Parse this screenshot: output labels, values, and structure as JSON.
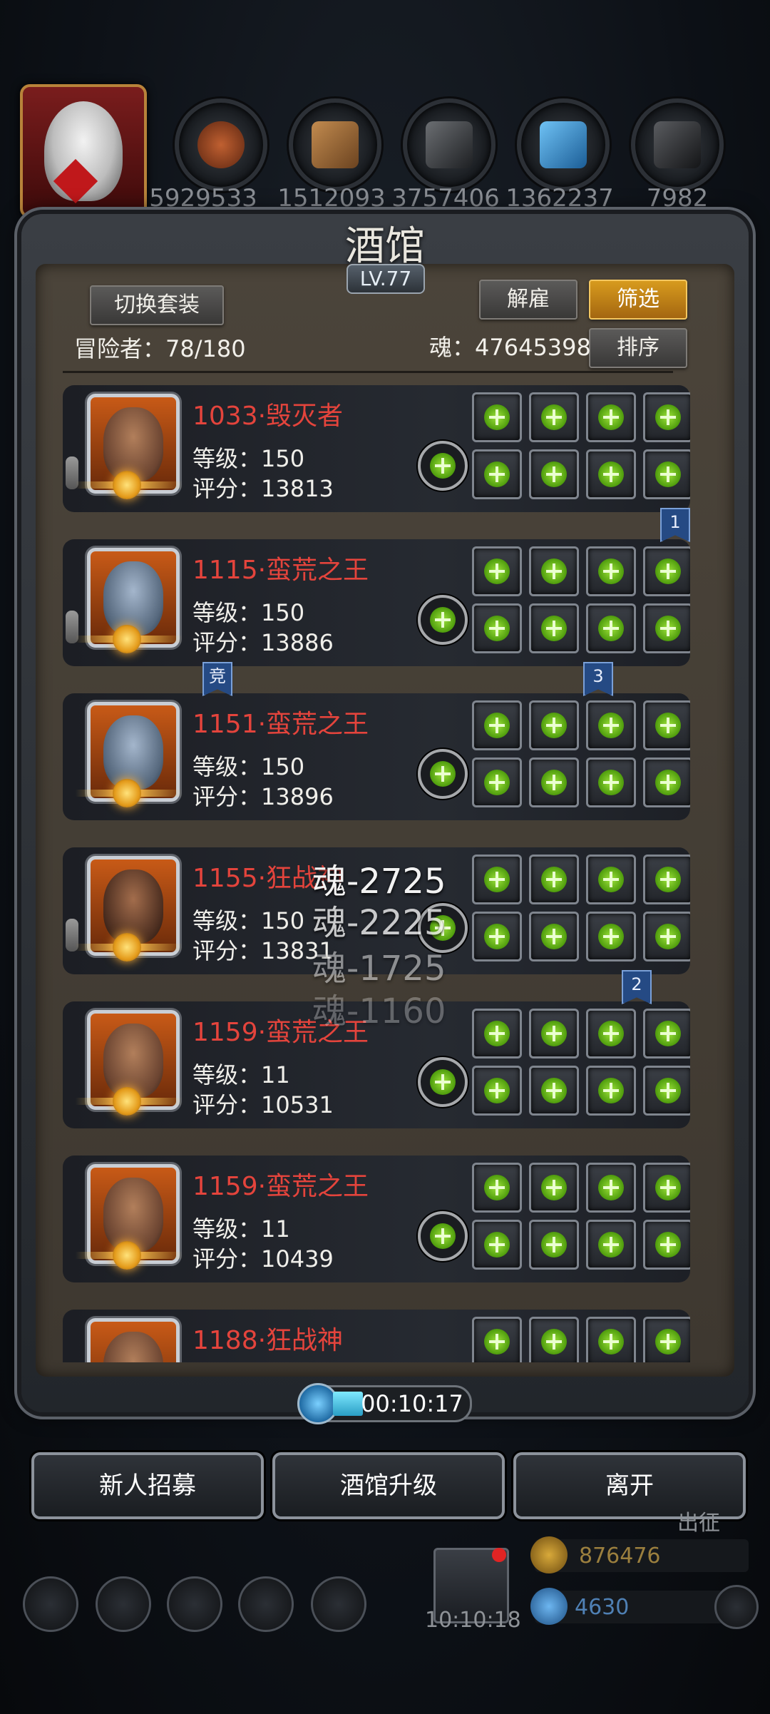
{
  "resources": [
    "5929533",
    "1512093",
    "3757406",
    "1362237",
    "7982"
  ],
  "title": "酒馆",
  "level": "LV.77",
  "buttons": {
    "switch_outfit": "切换套装",
    "dismiss": "解雇",
    "filter": "筛选",
    "sort": "排序"
  },
  "adventurers_label": "冒险者：78/180",
  "soul_label": "魂：47645398",
  "heroes": [
    {
      "name": "1033·毁灭者",
      "level": "等级：150",
      "score": "评分：13813"
    },
    {
      "name": "1115·蛮荒之王",
      "level": "等级：150",
      "score": "评分：13886"
    },
    {
      "name": "1151·蛮荒之王",
      "level": "等级：150",
      "score": "评分：13896"
    },
    {
      "name": "1155·狂战神",
      "level": "等级：150",
      "score": "评分：13831"
    },
    {
      "name": "1159·蛮荒之王",
      "level": "等级：11",
      "score": "评分：10531"
    },
    {
      "name": "1159·蛮荒之王",
      "level": "等级：11",
      "score": "评分：10439"
    },
    {
      "name": "1188·狂战神",
      "level": "",
      "score": ""
    }
  ],
  "ribbons": {
    "r1": "1",
    "r2": "竞",
    "r3": "3",
    "r4": "2"
  },
  "floating_texts": [
    "魂-2725",
    "魂-2225",
    "魂-1725",
    "魂-1160"
  ],
  "timer": "00:10:17",
  "bottom_buttons": {
    "recruit": "新人招募",
    "upgrade": "酒馆升级",
    "leave": "离开"
  },
  "bottom": {
    "gift_timer": "10:10:18",
    "gold": "876476",
    "gems": "4630",
    "side_text": "出征"
  },
  "colors": {
    "hero_name": "#e4443c",
    "accent_gold": "#d79b1e",
    "plus_green": "#6fd91c"
  }
}
